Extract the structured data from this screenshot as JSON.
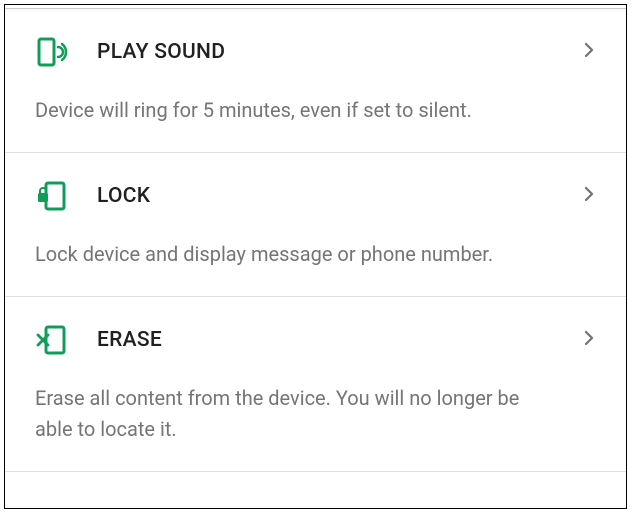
{
  "actions": [
    {
      "icon": "phone-ring-icon",
      "title": "PLAY SOUND",
      "description": "Device will ring for 5 minutes, even if set to silent."
    },
    {
      "icon": "phone-lock-icon",
      "title": "LOCK",
      "description": "Lock device and display message or phone number."
    },
    {
      "icon": "phone-erase-icon",
      "title": "ERASE",
      "description": "Erase all content from the device. You will no longer be able to locate it."
    }
  ],
  "colors": {
    "accent": "#0F9D58",
    "text_primary": "#202020",
    "text_secondary": "#757575"
  }
}
